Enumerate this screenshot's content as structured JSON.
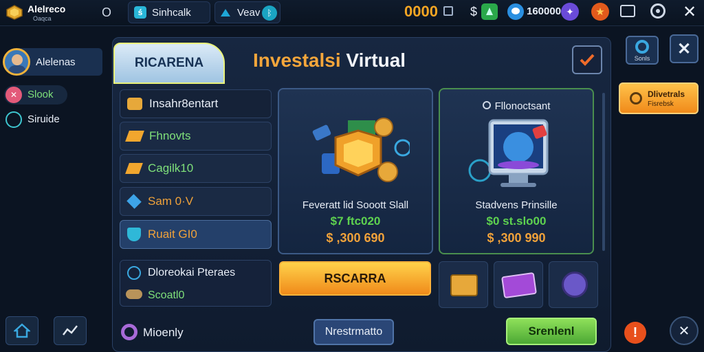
{
  "topbar": {
    "profile_name": "Alelreco",
    "profile_sub": "Oaqca",
    "close_glyph": "O",
    "tab1": "Sinhcalk",
    "tab2": "Veav",
    "currency_value": "0000",
    "currency2_symbol": "$",
    "gems_value": "160000"
  },
  "sidebar": {
    "user_name": "Alelenas",
    "item1": "Slook",
    "item2": "Siruide"
  },
  "panel": {
    "tab_label": "RICARENA",
    "title_part1": "Investalsi",
    "title_part2": "Virtual"
  },
  "list": {
    "item1": "Insahr8entart",
    "item2": "Fhnovts",
    "item3": "Cagilk10",
    "item4": "Sam 0·V",
    "item5": "Ruait GI0",
    "bottom1": "Dloreokai Pteraes",
    "bottom2": "Scoatl0"
  },
  "cards": {
    "card1_title": "Feveratt lid Sooott Slall",
    "card1_green": "$7 ftc020",
    "card1_orange": "$ ,300 690",
    "card2_header": "Fllonoctsant",
    "card2_title": "Stadvens Prinsille",
    "card2_green": "$0 st.slo00",
    "card2_orange": "$ ,300 990"
  },
  "buttons": {
    "main_action": "RSCARRA",
    "mid_button": "Nrestrmatto",
    "green_button": "Srenlenl",
    "bottom_left_label": "Mioenly"
  },
  "right": {
    "button1_label": "Sonls",
    "orange_title": "Dlivetrals",
    "orange_sub": "Fisrebsk"
  },
  "colors": {
    "accent_orange": "#f39a1e",
    "accent_green": "#6bd35a",
    "price_green": "#5ed24f",
    "price_orange": "#f0a23a"
  }
}
